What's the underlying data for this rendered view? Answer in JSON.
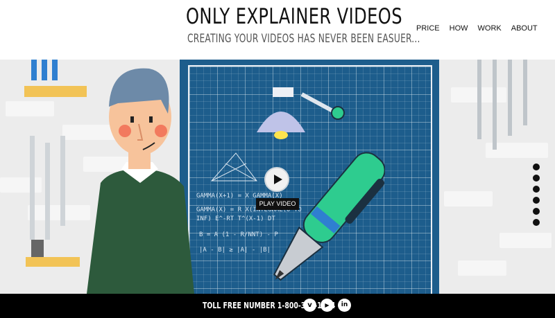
{
  "header": {
    "title": "ONLY EXPLAINER VIDEOS",
    "tagline": "CREATING YOUR VIDEOS HAS NEVER BEEN EASUER..."
  },
  "nav": {
    "items": [
      {
        "label": "PRICE"
      },
      {
        "label": "HOW"
      },
      {
        "label": "WORK"
      },
      {
        "label": "ABOUT"
      }
    ]
  },
  "hero": {
    "play_label": "PLAY VIDEO",
    "formulas": [
      "GAMMA(X+1) = X GAMMA(X)",
      "GAMMA(X) = R X(INTEGRAL(0 TO",
      "INF) E^-RT T^(X-1) DT",
      "B = A (1 - R/NNT) - P",
      "|A - B| ≥ |A| - |B|"
    ],
    "slide_count": 6,
    "colors": {
      "board": "#1d5d8c",
      "wall": "#ececec",
      "accent_green": "#2ecc8f"
    }
  },
  "footer": {
    "phone_text": "TOLL FREE NUMBER 1-800-361-1384",
    "social": [
      {
        "icon": "vimeo-icon",
        "glyph": "v"
      },
      {
        "icon": "youtube-icon",
        "glyph": "▶"
      },
      {
        "icon": "linkedin-icon",
        "glyph": "in"
      }
    ]
  }
}
